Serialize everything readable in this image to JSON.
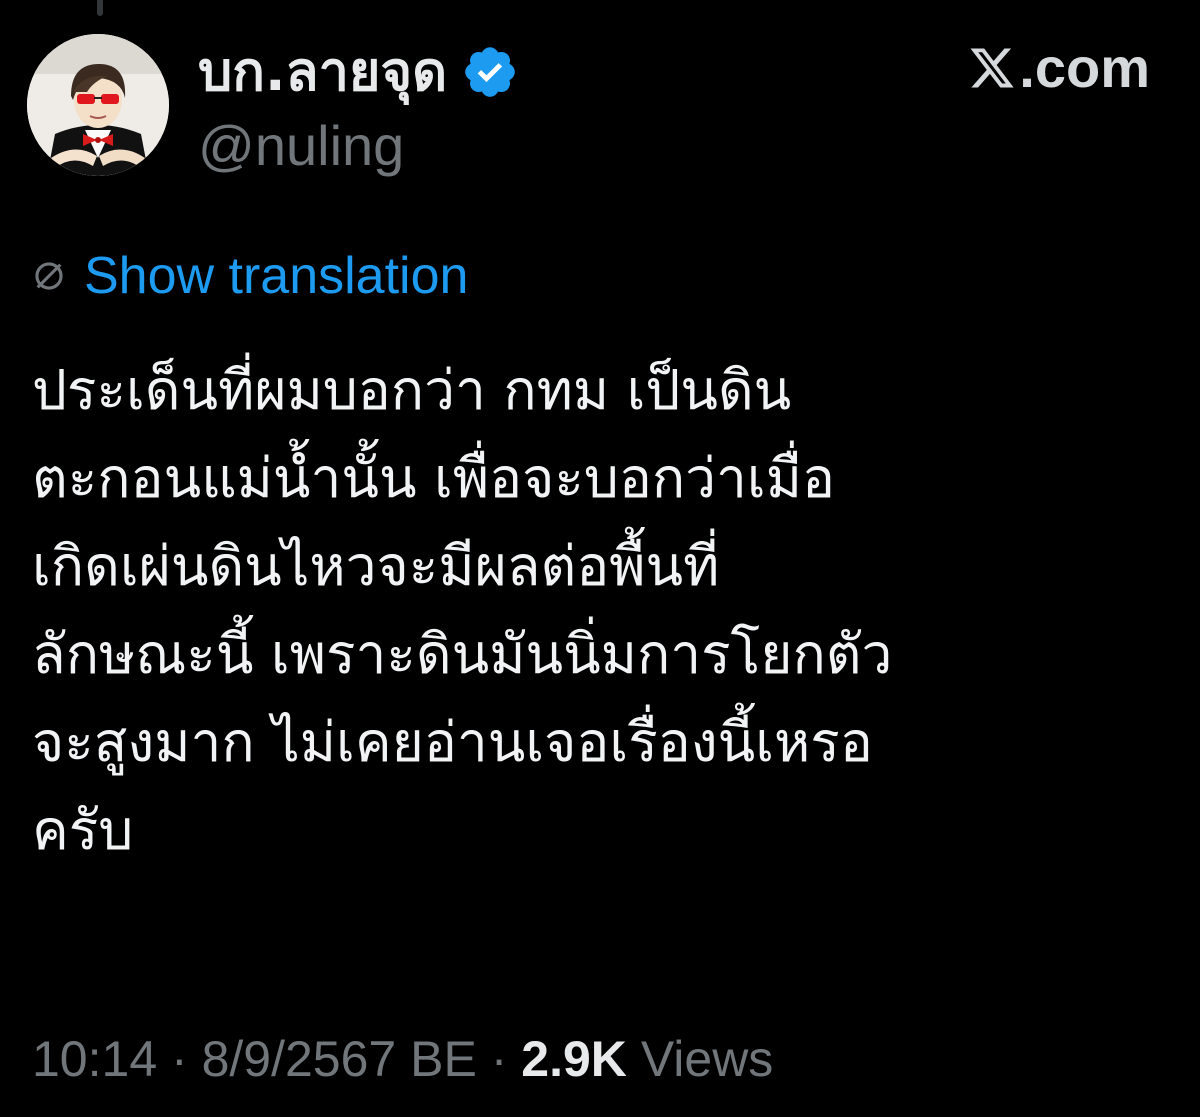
{
  "author": {
    "display_name": "บก.ลายจุด",
    "handle": "@nuling",
    "verified": true,
    "avatar": "avatar-photo"
  },
  "brand": {
    "label": ".com",
    "icon": "x-logo-icon"
  },
  "translate": {
    "icon": "globe-icon",
    "label": "Show translation"
  },
  "tweet": {
    "text": "ประเด็นที่ผมบอกว่า กทม เป็นดิน\nตะกอนแม่น้ำนั้น เพื่อจะบอกว่าเมื่อ\nเกิดเผ่นดินไหวจะมีผลต่อพื้นที่\nลักษณะนี้ เพราะดินมันนิ่มการโยกตัว\nจะสูงมาก ไม่เคยอ่านเจอเรื่องนี้เหรอ\nครับ"
  },
  "meta": {
    "time": "10:14",
    "separator": "·",
    "date": "8/9/2567 BE",
    "views_count": "2.9K",
    "views_label": "Views"
  },
  "colors": {
    "background": "#000000",
    "text": "#e7e9ea",
    "secondary": "#71767b",
    "link": "#1d9bf0",
    "verified": "#1d9bf0"
  }
}
